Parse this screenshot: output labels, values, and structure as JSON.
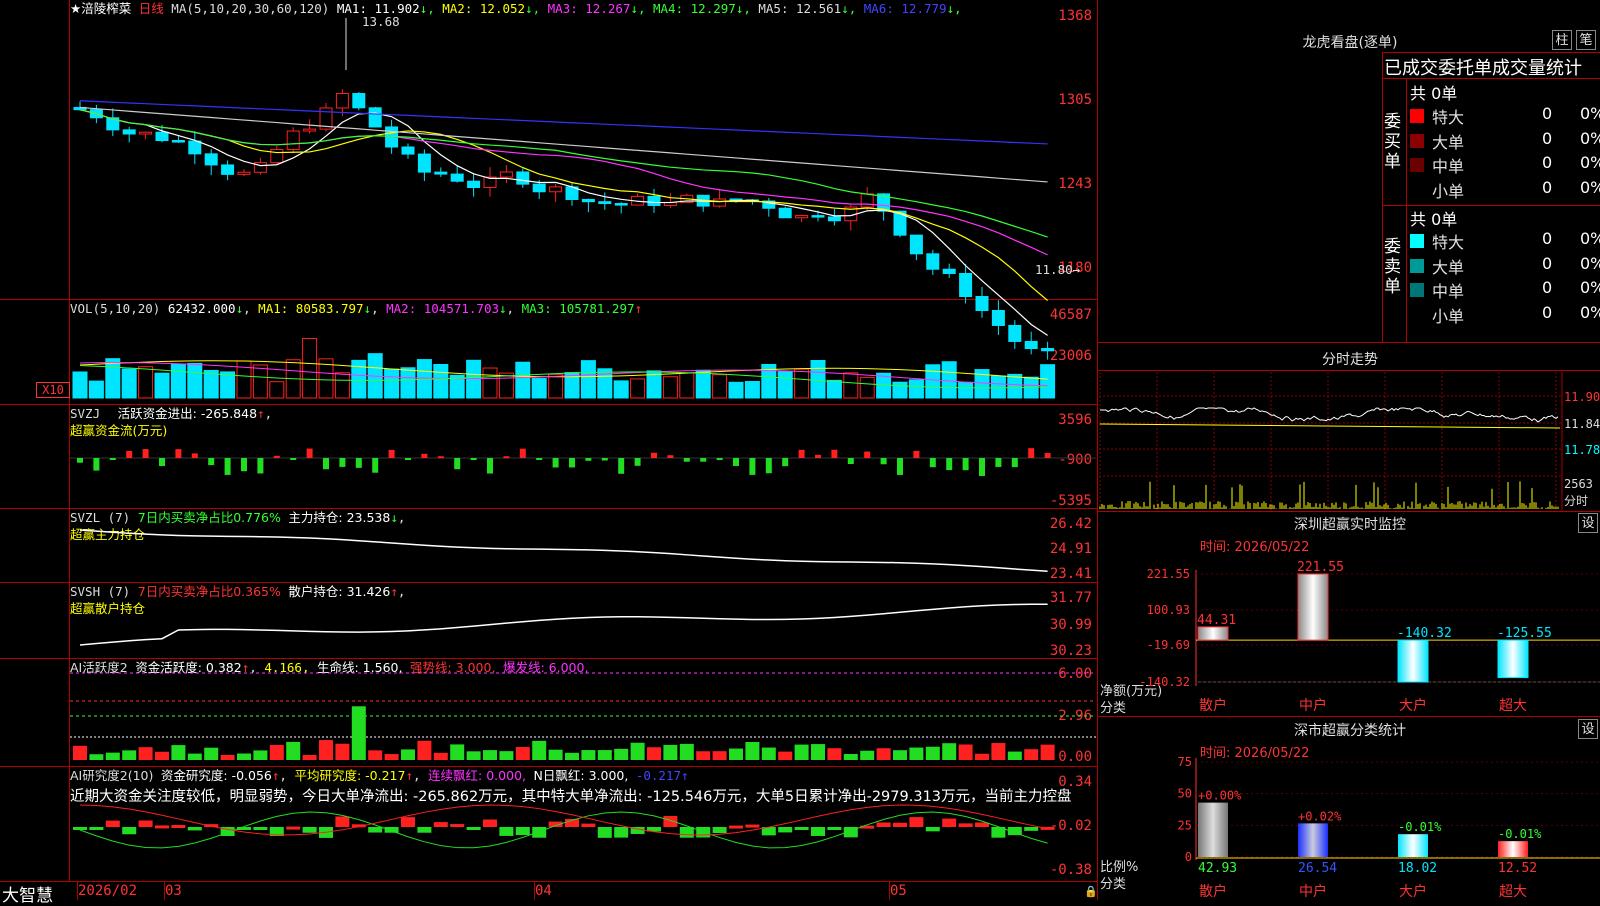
{
  "stock": {
    "name": "★涪陵榨菜",
    "period": "日线",
    "ma_header": "MA(5,10,20,30,60,120)",
    "ma_values": [
      {
        "label": "MA1: 11.902",
        "arrow": "↓",
        "color": "#ffffff"
      },
      {
        "label": "MA2: 12.052",
        "arrow": "↓",
        "color": "#ffff00"
      },
      {
        "label": "MA3: 12.267",
        "arrow": "↓",
        "color": "#ff33ff"
      },
      {
        "label": "MA4: 12.297",
        "arrow": "↓",
        "color": "#33ff33"
      },
      {
        "label": "MA5: 12.561",
        "arrow": "↓",
        "color": "#dddddd"
      },
      {
        "label": "MA6: 12.779",
        "arrow": "↓",
        "color": "#4444ff"
      }
    ],
    "high_label": "13.68",
    "low_label": "11.80",
    "y_labels": [
      "1368",
      "1305",
      "1243",
      "1180"
    ]
  },
  "vol": {
    "header": "VOL(5,10,20)",
    "value": "62432.000",
    "ma1": "MA1: 80583.797",
    "ma2": "MA2: 104571.703",
    "ma3": "MA3: 105781.297",
    "y_labels": [
      "46587",
      "23006"
    ],
    "unit": "X10"
  },
  "svzj": {
    "header": "SVZJ",
    "title": "活跃资金进出: -265.848",
    "sub": "超赢资金流(万元)",
    "y_labels": [
      "3596",
      "-900",
      "-5395"
    ]
  },
  "svzl": {
    "header": "SVZL (7)",
    "desc": "7日内买卖净占比0.776%",
    "main": "主力持仓: 23.538",
    "sub": "超赢主力持仓",
    "y_labels": [
      "26.42",
      "24.91",
      "23.41"
    ]
  },
  "svsh": {
    "header": "SVSH (7)",
    "desc": "7日内买卖净占比0.365%",
    "main": "散户持仓: 31.426",
    "sub": "超赢散户持仓",
    "y_labels": [
      "31.77",
      "30.99",
      "30.23"
    ]
  },
  "ai1": {
    "header": "AI活跃度2",
    "a": "资金活跃度: 0.382",
    "b": "4.166,",
    "c": "生命线: 1.560,",
    "d": "强势线: 3.000,",
    "e": "爆发线: 6.000,",
    "y_labels": [
      "6.00",
      "2.96",
      "0.00"
    ]
  },
  "ai2": {
    "header": "AI研究度2(10)",
    "a": "资金研究度: -0.056",
    "b": "平均研究度: -0.217",
    "c": "连续飘红: 0.000,",
    "d": "N日飘红: 3.000,",
    "e": "-0.217",
    "comment": "近期大资金关注度较低，明显弱势，今日大单净流出: -265.862万元，其中特大单净流出: -125.546万元，大单5日累计净出-2979.313万元，当前主力控盘",
    "y_labels": [
      "0.34",
      "-0.02",
      "-0.38"
    ]
  },
  "bottom": {
    "logo": "大智慧",
    "dates": [
      "2026/02",
      "03",
      "04",
      "05"
    ]
  },
  "dragon": {
    "title": "龙虎看盘(逐单)",
    "btn1": "柱",
    "btn2": "笔",
    "subtitle": "已成交委托单成交量统计",
    "buy_label": "委买单",
    "sell_label": "委卖单",
    "buy_total": "共 0单",
    "sell_total": "共 0单",
    "buy_rows": [
      {
        "name": "特大",
        "n": "0",
        "p": "0%",
        "color": "#ff0000"
      },
      {
        "name": "大单",
        "n": "0",
        "p": "0%",
        "color": "#8b0000"
      },
      {
        "name": "中单",
        "n": "0",
        "p": "0%",
        "color": "#6b0000"
      },
      {
        "name": "小单",
        "n": "0",
        "p": "0%",
        "color": "#000000"
      }
    ],
    "sell_rows": [
      {
        "name": "特大",
        "n": "0",
        "p": "0%",
        "color": "#00ffff"
      },
      {
        "name": "大单",
        "n": "0",
        "p": "0%",
        "color": "#009999"
      },
      {
        "name": "中单",
        "n": "0",
        "p": "0%",
        "color": "#007777"
      },
      {
        "name": "小单",
        "n": "0",
        "p": "0%",
        "color": "#000000"
      }
    ]
  },
  "intraday": {
    "title": "分时走势",
    "prices": [
      "11.90",
      "11.84",
      "11.78"
    ],
    "vol_label": "2563",
    "vol_unit": "分时"
  },
  "monitor": {
    "title": "深圳超赢实时监控",
    "btn": "设",
    "time": "时间: 2026/05/22",
    "ylabel": "净额(万元)",
    "xlabel": "分类",
    "y_labels": [
      "221.55",
      "100.93",
      "-19.69",
      "-140.32"
    ],
    "categories": [
      "散户",
      "中户",
      "大户",
      "超大"
    ],
    "values": [
      44.31,
      221.55,
      -140.32,
      -125.55
    ],
    "value_labels": [
      "44.31",
      "221.55",
      "-140.32",
      "-125.55"
    ]
  },
  "classify": {
    "title": "深市超赢分类统计",
    "btn": "设",
    "time": "时间: 2026/05/22",
    "ylabel": "比例%",
    "xlabel": "分类",
    "y_labels": [
      "75",
      "50",
      "25",
      "0"
    ],
    "categories": [
      "散户",
      "中户",
      "大户",
      "超大"
    ],
    "values": [
      42.93,
      26.54,
      18.02,
      12.52
    ],
    "changes": [
      "+0.00%",
      "+0.02%",
      "-0.01%",
      "-0.01%"
    ],
    "value_labels": [
      "42.93",
      "26.54",
      "18.02",
      "12.52"
    ]
  }
}
